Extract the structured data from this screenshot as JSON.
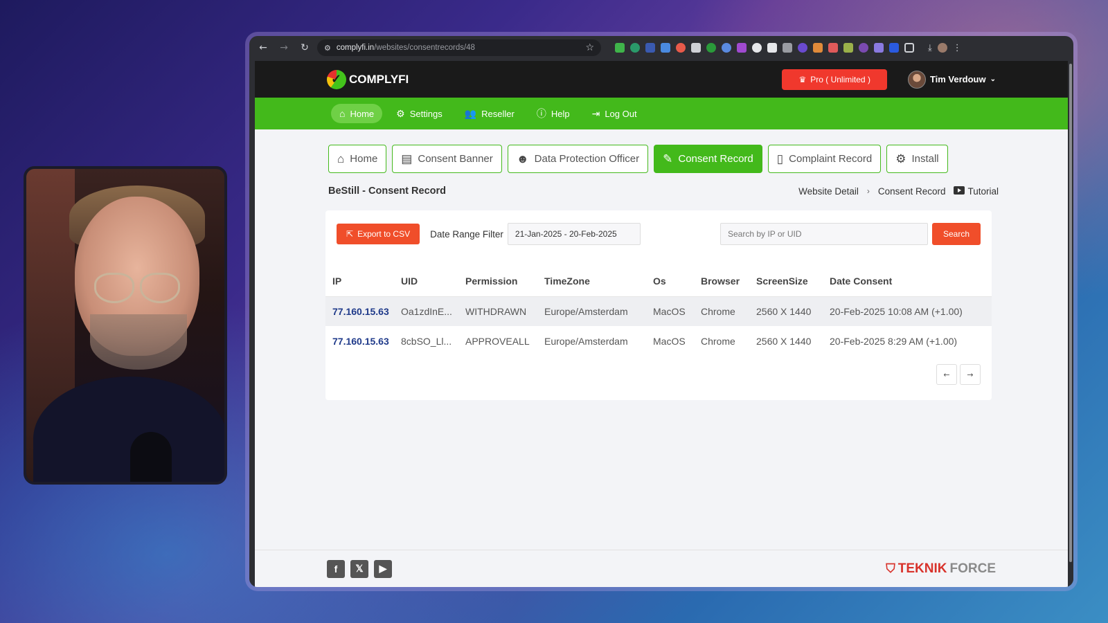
{
  "browser": {
    "url_domain": "complyfi.in",
    "url_path": "/websites/consentrecords/48"
  },
  "header": {
    "logo_text": "COMPLYFI",
    "pro_label": "Pro ( Unlimited )",
    "user_name": "Tim Verdouw"
  },
  "green_nav": [
    {
      "label": "Home",
      "icon": "home-icon",
      "active": true
    },
    {
      "label": "Settings",
      "icon": "gear-icon",
      "active": false
    },
    {
      "label": "Reseller",
      "icon": "users-icon",
      "active": false
    },
    {
      "label": "Help",
      "icon": "help-icon",
      "active": false
    },
    {
      "label": "Log Out",
      "icon": "logout-icon",
      "active": false
    }
  ],
  "tabs": [
    {
      "label": "Home",
      "icon": "home-icon",
      "active": false
    },
    {
      "label": "Consent Banner",
      "icon": "banner-icon",
      "active": false
    },
    {
      "label": "Data Protection Officer",
      "icon": "officer-icon",
      "active": false
    },
    {
      "label": "Consent Record",
      "icon": "record-icon",
      "active": true
    },
    {
      "label": "Complaint Record",
      "icon": "document-icon",
      "active": false
    },
    {
      "label": "Install",
      "icon": "gear-icon",
      "active": false
    }
  ],
  "page": {
    "title": "BeStill - Consent Record",
    "breadcrumb": [
      "Website Detail",
      "Consent Record"
    ],
    "tutorial_label": "Tutorial"
  },
  "toolbar": {
    "export_label": "Export to CSV",
    "date_range_label": "Date Range Filter",
    "date_range_value": "21-Jan-2025 - 20-Feb-2025",
    "search_placeholder": "Search by IP or UID",
    "search_label": "Search"
  },
  "table": {
    "columns": [
      "IP",
      "UID",
      "Permission",
      "TimeZone",
      "Os",
      "Browser",
      "ScreenSize",
      "Date Consent"
    ],
    "rows": [
      [
        "77.160.15.63",
        "Oa1zdInE...",
        "WITHDRAWN",
        "Europe/Amsterdam",
        "MacOS",
        "Chrome",
        "2560 X 1440",
        "20-Feb-2025 10:08 AM (+1.00)"
      ],
      [
        "77.160.15.63",
        "8cbSO_Ll...",
        "APPROVEALL",
        "Europe/Amsterdam",
        "MacOS",
        "Chrome",
        "2560 X 1440",
        "20-Feb-2025 8:29 AM (+1.00)"
      ]
    ]
  },
  "pager": {
    "prev": "←",
    "next": "→"
  },
  "footer": {
    "social": [
      "facebook-icon",
      "x-icon",
      "youtube-icon"
    ],
    "brand_part1": "TEKNIK",
    "brand_part2": "FORCE"
  },
  "colors": {
    "accent_green": "#43b91b",
    "accent_orange": "#f04e2a",
    "pro_red": "#f0382d"
  }
}
